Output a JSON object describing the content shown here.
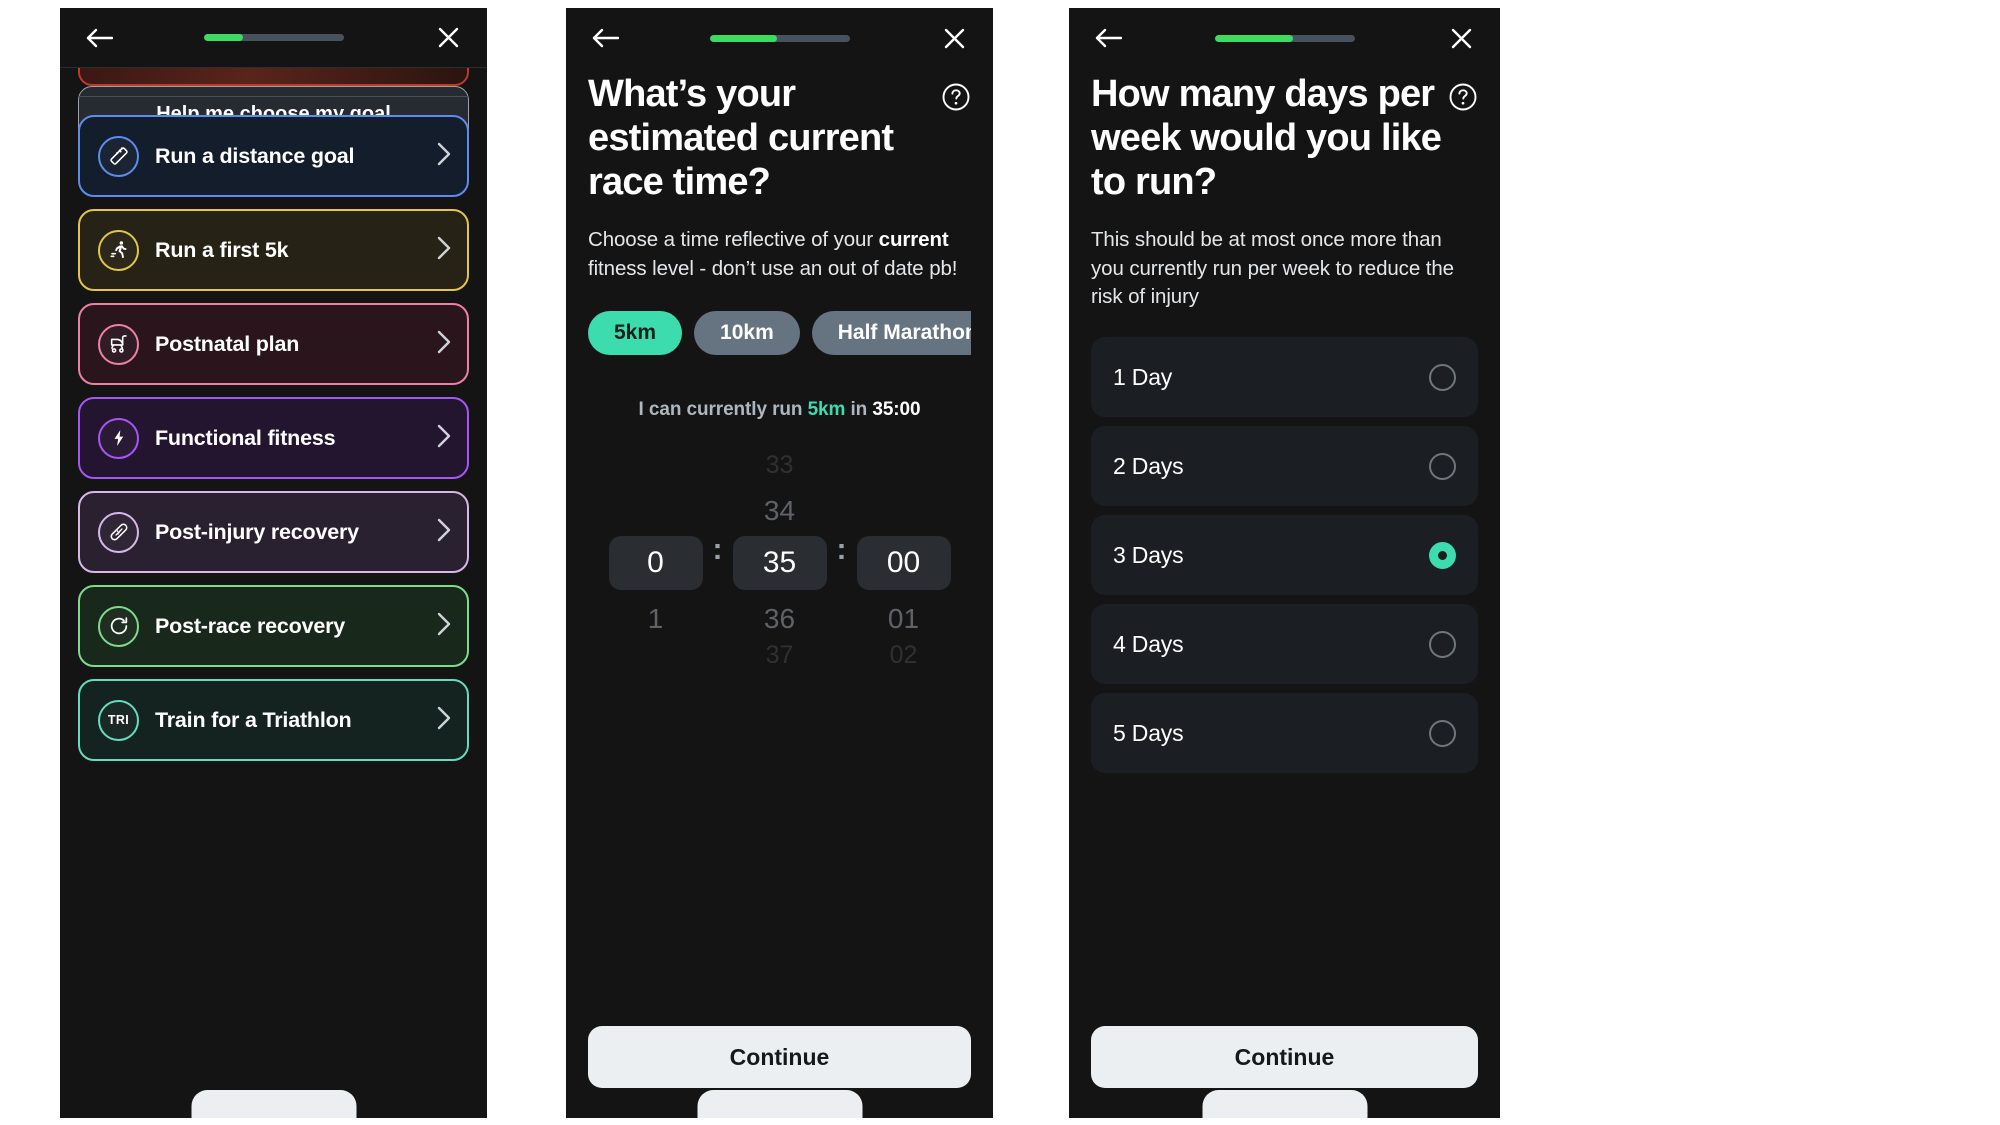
{
  "screens": [
    {
      "name": "goal-picker",
      "topbar": {
        "back_icon": "arrow-left-icon",
        "close_icon": "close-icon",
        "progress_percent": 28
      },
      "goals": [
        {
          "label": "Run a distance goal",
          "icon": "ruler-icon",
          "accent": "#5b8def",
          "bg": "#141d2c"
        },
        {
          "label": "Run a first 5k",
          "icon": "runner-icon",
          "accent": "#e3c54a",
          "bg": "#262215"
        },
        {
          "label": "Postnatal plan",
          "icon": "stroller-icon",
          "accent": "#ef7fa5",
          "bg": "#2a151d"
        },
        {
          "label": "Functional fitness",
          "icon": "bolt-icon",
          "accent": "#a855f7",
          "bg": "#231430"
        },
        {
          "label": "Post-injury recovery",
          "icon": "bandage-icon",
          "accent": "#d9b6ea",
          "bg": "#2a2130"
        },
        {
          "label": "Post-race recovery",
          "icon": "refresh-icon",
          "accent": "#7ddc8a",
          "bg": "#18281a"
        },
        {
          "label": "Train for a Triathlon",
          "icon": "tri-icon",
          "accent": "#63dcc0",
          "bg": "#14231f",
          "icon_text": "TRI"
        }
      ],
      "help_button": "Help me choose my goal",
      "chevron_icon": "chevron-right-icon"
    },
    {
      "name": "race-time",
      "topbar": {
        "back_icon": "arrow-left-icon",
        "close_icon": "close-icon",
        "progress_percent": 48
      },
      "title": "What’s your estimated current race time?",
      "help_icon": "question-circle-icon",
      "subtitle_parts": [
        {
          "text": "Choose a time reflective of your ",
          "bold": false
        },
        {
          "text": "current",
          "bold": true
        },
        {
          "text": " fitness level - don’t use an out of date pb!",
          "bold": false
        }
      ],
      "distance_pills": [
        {
          "label": "5km",
          "selected": true
        },
        {
          "label": "10km",
          "selected": false
        },
        {
          "label": "Half Marathon",
          "selected": false
        }
      ],
      "summary": {
        "prefix": "I can currently run ",
        "distance": "5km",
        "mid": " in ",
        "time": "35:00"
      },
      "picker": {
        "hours": {
          "above2": "",
          "above1": "",
          "value": "0",
          "below1": "1",
          "below2": ""
        },
        "minutes": {
          "above2": "33",
          "above1": "34",
          "value": "35",
          "below1": "36",
          "below2": "37"
        },
        "seconds": {
          "above2": "",
          "above1": "",
          "value": "00",
          "below1": "01",
          "below2": "02"
        },
        "separator": ":"
      },
      "continue_label": "Continue"
    },
    {
      "name": "days-per-week",
      "topbar": {
        "back_icon": "arrow-left-icon",
        "close_icon": "close-icon",
        "progress_percent": 56
      },
      "title": "How many days per week would you like to run?",
      "help_icon": "question-circle-icon",
      "subtitle": "This should be at most once more than you currently run per week to reduce the risk of injury",
      "options": [
        {
          "label": "1 Day",
          "selected": false
        },
        {
          "label": "2 Days",
          "selected": false
        },
        {
          "label": "3 Days",
          "selected": true
        },
        {
          "label": "4 Days",
          "selected": false
        },
        {
          "label": "5 Days",
          "selected": false
        }
      ],
      "continue_label": "Continue"
    }
  ],
  "colors": {
    "accent_green": "#3ddc61",
    "accent_teal": "#3ddcae",
    "app_bg": "#141414",
    "card_bg": "#1b1f23"
  }
}
